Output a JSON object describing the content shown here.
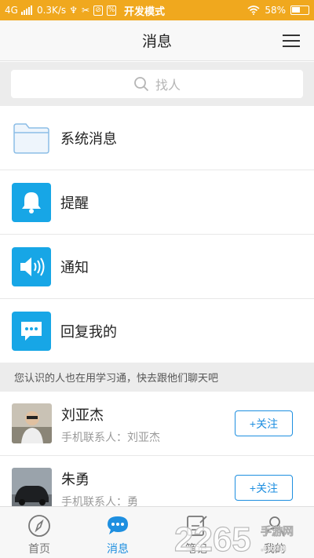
{
  "status": {
    "network": "4G",
    "speed": "0.3K/s",
    "icon_glyph_a": "♆",
    "icon_glyph_b": "✂",
    "box_a": "⊘",
    "box_b": "%",
    "mode": "开发模式",
    "battery_text": "58%",
    "battery_level": 0.58
  },
  "header": {
    "title": "消息"
  },
  "search": {
    "placeholder": "找人"
  },
  "menu": [
    {
      "label": "系统消息",
      "icon": "folder-icon"
    },
    {
      "label": "提醒",
      "icon": "bell-icon"
    },
    {
      "label": "通知",
      "icon": "speaker-icon"
    },
    {
      "label": "回复我的",
      "icon": "chat-bubble-icon"
    }
  ],
  "hint": "您认识的人也在用学习通，快去跟他们聊天吧",
  "contacts": [
    {
      "name": "刘亚杰",
      "sub": "手机联系人：刘亚杰",
      "button": "+关注"
    },
    {
      "name": "朱勇",
      "sub": "手机联系人：勇",
      "button": "+关注"
    }
  ],
  "tabs": [
    {
      "label": "首页",
      "icon": "compass-icon"
    },
    {
      "label": "消息",
      "icon": "chat-icon",
      "active": true
    },
    {
      "label": "笔记",
      "icon": "note-icon"
    },
    {
      "label": "我的",
      "icon": "user-icon"
    }
  ],
  "watermark": {
    "number": "2265",
    "suffix": ".com",
    "tagline": "手游网"
  },
  "colors": {
    "status_bar": "#f0a81e",
    "accent": "#1e8fe0",
    "icon_blue": "#17a6e6"
  }
}
